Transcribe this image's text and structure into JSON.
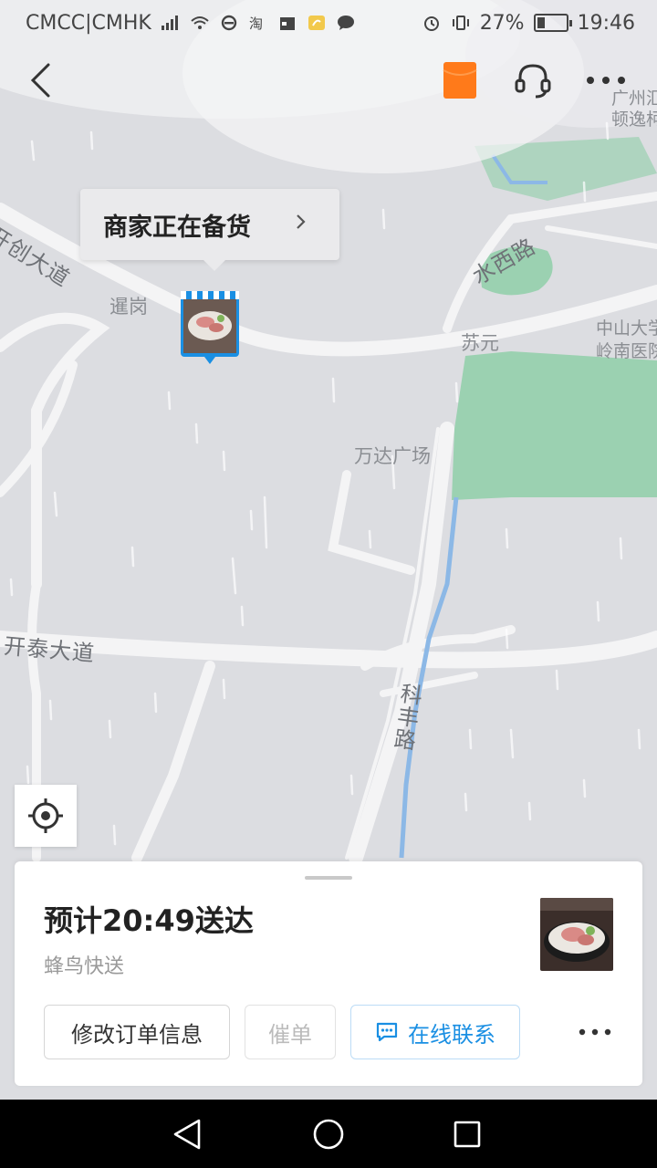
{
  "status_bar": {
    "carrier": "CMCC|CMHK",
    "battery_percent_text": "27%",
    "battery_level": 0.27,
    "time": "19:46"
  },
  "map": {
    "place_labels": {
      "gangdong_top": "广州汇",
      "gangdong_top2": "顿逸柯",
      "shiguan": "暹岗",
      "suyuan": "苏元",
      "zhongshan1": "中山大学",
      "zhongshan2": "岭南医院",
      "wanda": "万达广场"
    },
    "road_labels": {
      "kaichuang": "开创大道",
      "shuixi": "水西路",
      "kaitai": "开泰大道",
      "kefeng": "科丰路"
    }
  },
  "callout": {
    "text": "商家正在备货"
  },
  "order_card": {
    "eta": "预计20:49送达",
    "courier": "蜂鸟快送",
    "buttons": {
      "modify": "修改订单信息",
      "urge": "催单",
      "chat": "在线联系"
    }
  },
  "colors": {
    "accent_blue": "#1a8fe3",
    "hongbao_orange": "#ff7a1a",
    "map_green": "#8fcfa8"
  },
  "icons": {
    "back": "back-arrow-icon",
    "hongbao": "red-packet-icon",
    "service": "headset-icon",
    "more": "more-dots-icon",
    "locate": "locate-target-icon",
    "chat": "chat-bubble-icon"
  }
}
